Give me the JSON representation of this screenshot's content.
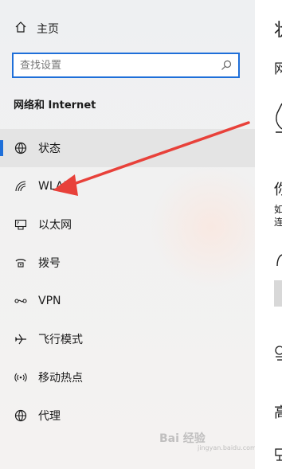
{
  "home": {
    "label": "主页",
    "icon": "home-icon"
  },
  "search": {
    "placeholder": "查找设置",
    "icon": "search-icon"
  },
  "section": {
    "title": "网络和 Internet"
  },
  "nav": {
    "items": [
      {
        "label": "状态",
        "icon": "globe-icon",
        "active": true
      },
      {
        "label": "WLAN",
        "icon": "wifi-icon",
        "active": false
      },
      {
        "label": "以太网",
        "icon": "ethernet-icon",
        "active": false
      },
      {
        "label": "拨号",
        "icon": "dialup-icon",
        "active": false
      },
      {
        "label": "VPN",
        "icon": "vpn-icon",
        "active": false
      },
      {
        "label": "飞行模式",
        "icon": "airplane-icon",
        "active": false
      },
      {
        "label": "移动热点",
        "icon": "hotspot-icon",
        "active": false
      },
      {
        "label": "代理",
        "icon": "globe-icon",
        "active": false
      }
    ]
  },
  "right_pane": {
    "title_fragment": "状",
    "subtitle_fragment": "网",
    "heading_fragment": "你",
    "line1_fragment": "如",
    "line2_fragment": "连",
    "heading2_fragment": "高"
  },
  "annotation": {
    "arrow_color": "#e8413a"
  },
  "watermark": {
    "text": "Bai 经验",
    "sub": "jingyan.baidu.com"
  },
  "colors": {
    "accent": "#1e6fd9",
    "active_bg": "#e4e4e4"
  }
}
